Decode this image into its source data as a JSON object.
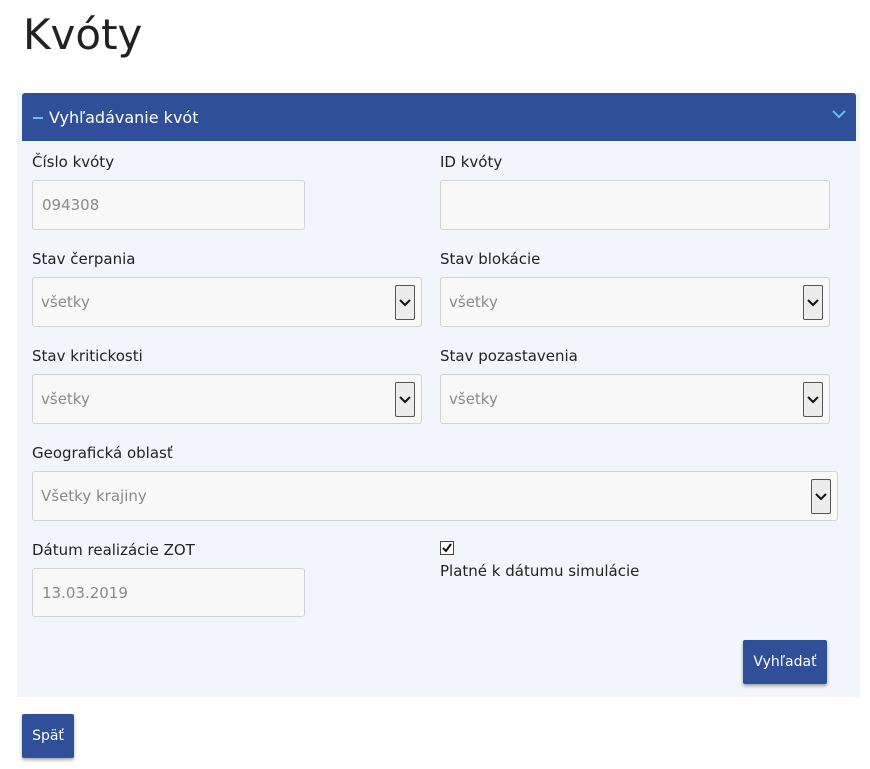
{
  "page": {
    "title": "Kvóty"
  },
  "panel": {
    "title": "Vyhľadávanie kvót"
  },
  "fields": {
    "cislo_kvoty": {
      "label": "Číslo kvóty",
      "value": "094308"
    },
    "id_kvoty": {
      "label": "ID kvóty",
      "value": ""
    },
    "stav_cerpania": {
      "label": "Stav čerpania",
      "selected": "všetky"
    },
    "stav_blokacie": {
      "label": "Stav blokácie",
      "selected": "všetky"
    },
    "stav_kritickosti": {
      "label": "Stav kritickosti",
      "selected": "všetky"
    },
    "stav_pozastavenia": {
      "label": "Stav pozastavenia",
      "selected": "všetky"
    },
    "geograficka_oblast": {
      "label": "Geografická oblasť",
      "selected": "Všetky krajiny"
    },
    "datum_realizacie": {
      "label": "Dátum realizácie ZOT",
      "value": "13.03.2019"
    },
    "platne_k_datumu": {
      "label": "Platné k dátumu simulácie",
      "checked": true
    }
  },
  "buttons": {
    "search": "Vyhľadať",
    "back": "Späť"
  },
  "colors": {
    "accent": "#2f4f98",
    "panel_bg": "#f2f6fc",
    "header_icon": "#5fc3f0"
  }
}
